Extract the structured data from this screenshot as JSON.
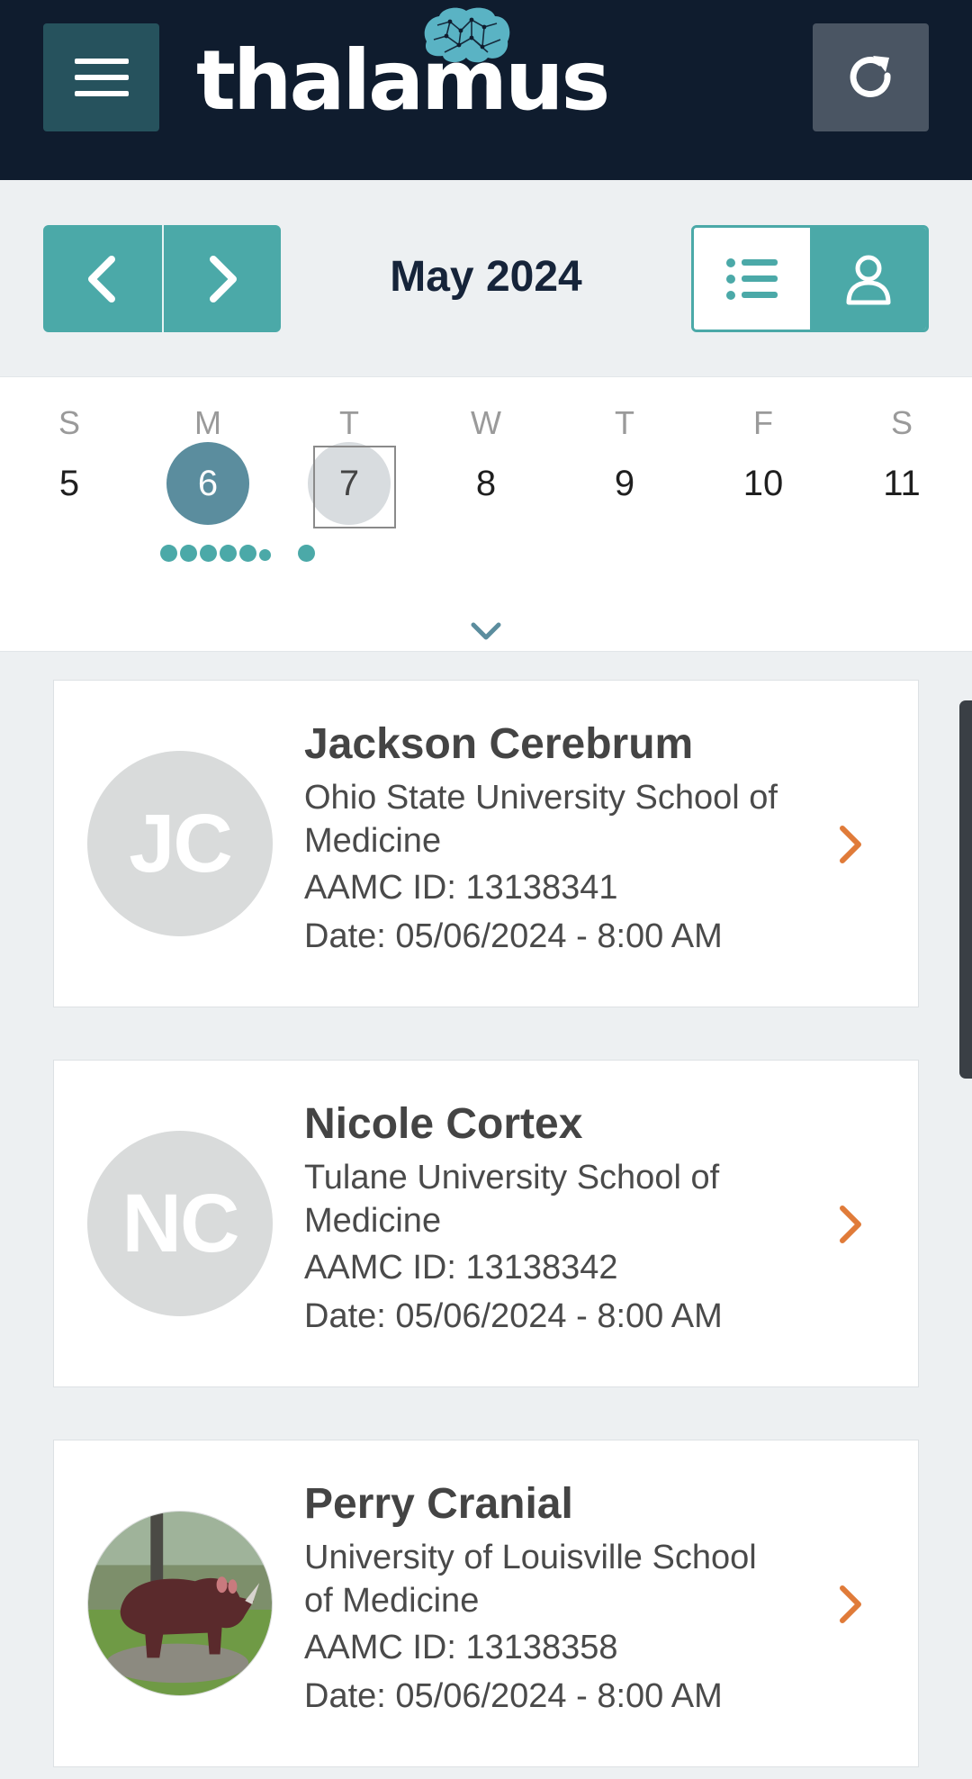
{
  "header": {
    "logo_text": "thalamus",
    "menu_icon": "hamburger-menu-icon",
    "refresh_icon": "refresh-icon",
    "colors": {
      "background": "#0f1c2e",
      "menu_button": "#26525d",
      "refresh_button": "#4a5563"
    }
  },
  "calendar": {
    "month_label": "May 2024",
    "prev_icon": "chevron-left-icon",
    "next_icon": "chevron-right-icon",
    "view_options": [
      "list-view-icon",
      "person-view-icon"
    ],
    "active_view": "person",
    "weekdays": [
      "S",
      "M",
      "T",
      "W",
      "T",
      "F",
      "S"
    ],
    "dates": [
      "5",
      "6",
      "7",
      "8",
      "9",
      "10",
      "11"
    ],
    "selected_date": "6",
    "today_date": "7",
    "colors": {
      "accent": "#4ba9a8",
      "selected": "#5b8d9e"
    }
  },
  "interviews": [
    {
      "initials": "JC",
      "name": "Jackson Cerebrum",
      "school_line1": "Ohio State University School of",
      "school_line2": "Medicine",
      "aamc": "AAMC ID: 13138341",
      "date": "Date: 05/06/2024 - 8:00 AM"
    },
    {
      "initials": "NC",
      "name": "Nicole Cortex",
      "school_line1": "Tulane University School of",
      "school_line2": "Medicine",
      "aamc": "AAMC ID: 13138342",
      "date": "Date: 05/06/2024 - 8:00 AM"
    },
    {
      "initials": "",
      "name": "Perry Cranial",
      "school_line1": "University of Louisville School",
      "school_line2": "of Medicine",
      "aamc": "AAMC ID: 13138358",
      "date": "Date: 05/06/2024 - 8:00 AM"
    }
  ]
}
